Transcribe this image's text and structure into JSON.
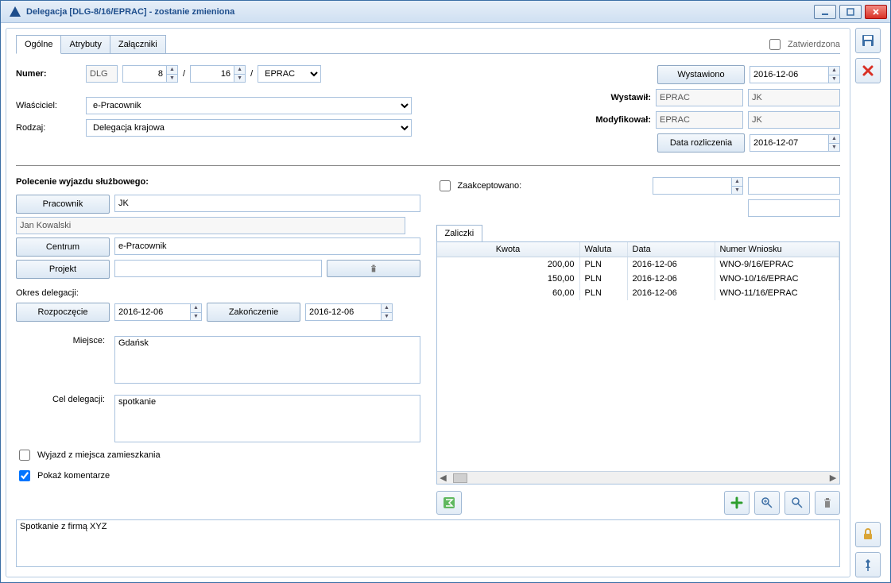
{
  "window": {
    "title": "Delegacja [DLG-8/16/EPRAC] - zostanie zmieniona"
  },
  "tabs": {
    "general": "Ogólne",
    "attributes": "Atrybuty",
    "attachments": "Załączniki"
  },
  "approved_label": "Zatwierdzona",
  "header": {
    "number_label": "Numer:",
    "prefix": "DLG",
    "seq": "8",
    "sep1": "/",
    "year": "16",
    "sep2": "/",
    "unit": "EPRAC",
    "owner_label": "Właściciel:",
    "owner": "e-Pracownik",
    "type_label": "Rodzaj:",
    "type": "Delegacja krajowa",
    "issued_btn": "Wystawiono",
    "issued_date": "2016-12-06",
    "issued_by_label": "Wystawił:",
    "issued_by_unit": "EPRAC",
    "issued_by_user": "JK",
    "modified_label": "Modyfikował:",
    "modified_unit": "EPRAC",
    "modified_user": "JK",
    "settle_btn": "Data rozliczenia",
    "settle_date": "2016-12-07"
  },
  "trip": {
    "title": "Polecenie wyjazdu służbowego:",
    "employee_btn": "Pracownik",
    "employee_code": "JK",
    "employee_name": "Jan Kowalski",
    "center_btn": "Centrum",
    "center": "e-Pracownik",
    "project_btn": "Projekt",
    "project": "",
    "period_label": "Okres delegacji:",
    "start_btn": "Rozpoczęcie",
    "start_date": "2016-12-06",
    "end_btn": "Zakończenie",
    "end_date": "2016-12-06",
    "place_label": "Miejsce:",
    "place": "Gdańsk",
    "purpose_label": "Cel delegacji:",
    "purpose": "spotkanie",
    "from_home_label": "Wyjazd z miejsca zamieszkania",
    "from_home_checked": false,
    "show_comments_label": "Pokaż komentarze",
    "show_comments_checked": true,
    "comments": "Spotkanie z firmą XYZ"
  },
  "accept": {
    "label": "Zaakceptowano:",
    "checked": false,
    "num": ""
  },
  "advances": {
    "tab": "Zaliczki",
    "cols": {
      "amount": "Kwota",
      "currency": "Waluta",
      "date": "Data",
      "reqno": "Numer Wniosku"
    },
    "rows": [
      {
        "amount": "200,00",
        "currency": "PLN",
        "date": "2016-12-06",
        "reqno": "WNO-9/16/EPRAC"
      },
      {
        "amount": "150,00",
        "currency": "PLN",
        "date": "2016-12-06",
        "reqno": "WNO-10/16/EPRAC"
      },
      {
        "amount": "60,00",
        "currency": "PLN",
        "date": "2016-12-06",
        "reqno": "WNO-11/16/EPRAC"
      }
    ]
  },
  "colors": {
    "accent": "#3b6ea5"
  }
}
